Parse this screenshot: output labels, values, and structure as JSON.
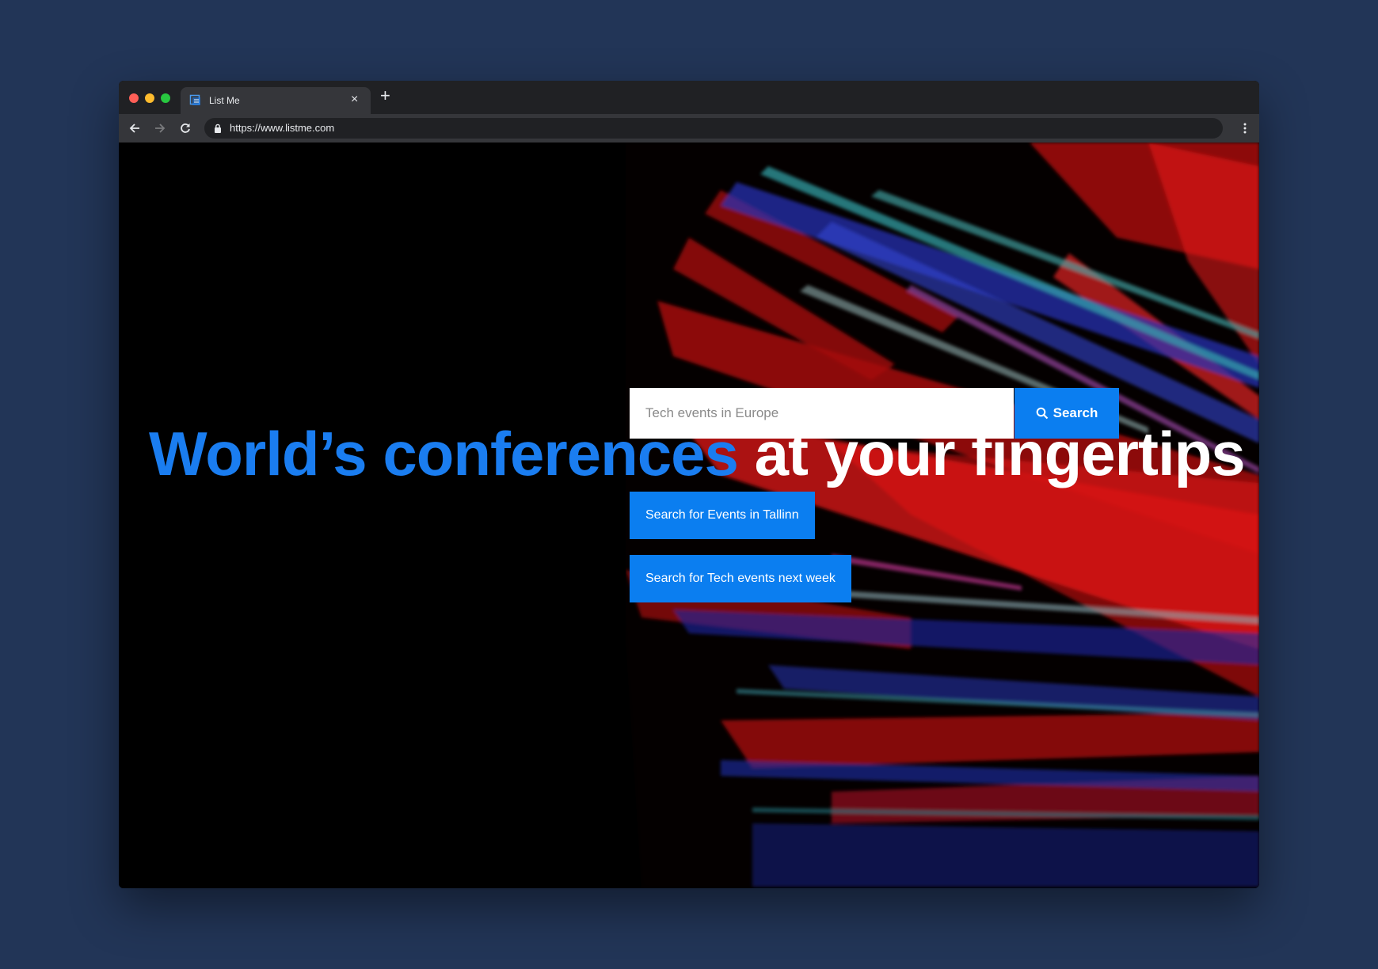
{
  "browser": {
    "tab_title": "List Me",
    "new_tab": "+",
    "tab_close": "×",
    "url": "https://www.listme.com",
    "icons": [
      "back-icon",
      "forward-icon",
      "reload-icon",
      "lock-icon",
      "more-vert-icon"
    ]
  },
  "hero": {
    "headline_part1": "World’s conferences",
    "headline_part2": " at your fingertips",
    "accent_color": "#1a7df0"
  },
  "search": {
    "placeholder": "Tech events in Europe",
    "button_label": "Search",
    "button_color": "#0b7ef0"
  },
  "quick_searches": [
    "Search for Events in Tallinn",
    "Search for Tech events next week"
  ],
  "colors": {
    "page_background": "#223557",
    "streak_red": "#e01010",
    "streak_blue": "#1b35d6",
    "streak_teal": "#2fb3b8"
  }
}
